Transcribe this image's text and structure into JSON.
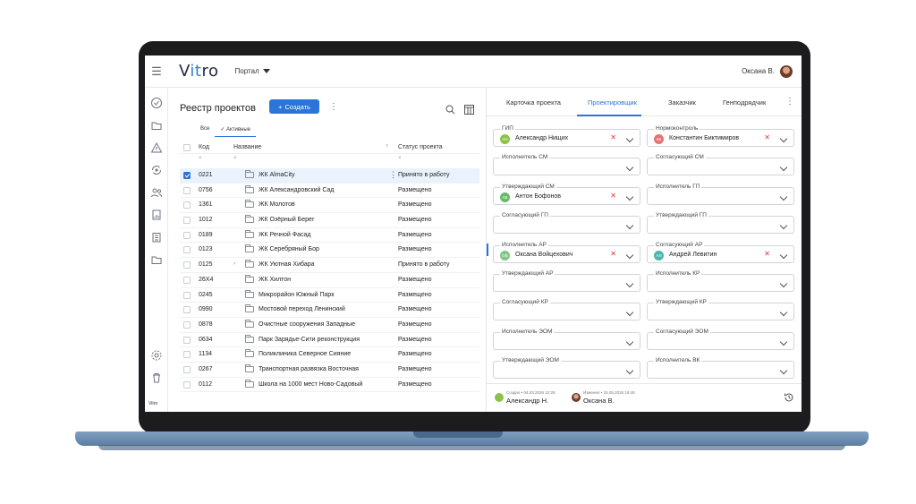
{
  "app": {
    "logo_pre": "V",
    "logo_it": "it",
    "logo_post": "ro",
    "portal": "Портал",
    "user_name": "Оксана В.",
    "brand_small": "Vitro"
  },
  "registry": {
    "title": "Реестр проектов",
    "create_label": "Создать",
    "filter_tabs": [
      "Все",
      "Активные"
    ],
    "columns": {
      "code": "Код",
      "name": "Название",
      "status": "Статус проекта"
    },
    "filter_placeholder": "×",
    "rows": [
      {
        "code": "0221",
        "name": "ЖК AlmaCity",
        "status": "Принято в работу"
      },
      {
        "code": "0756",
        "name": "ЖК Александровский Сад",
        "status": "Размещено"
      },
      {
        "code": "1361",
        "name": "ЖК Молотов",
        "status": "Размещено"
      },
      {
        "code": "1012",
        "name": "ЖК Озёрный Берег",
        "status": "Размещено"
      },
      {
        "code": "0189",
        "name": "ЖК Речной Фасад",
        "status": "Размещено"
      },
      {
        "code": "0123",
        "name": "ЖК Серебряный Бор",
        "status": "Размещено"
      },
      {
        "code": "0125",
        "name": "ЖК Уютная Хибара",
        "status": "Принято в работу"
      },
      {
        "code": "26Х4",
        "name": "ЖК Хилтон",
        "status": "Размещено"
      },
      {
        "code": "0245",
        "name": "Микрорайон Южный Парк",
        "status": "Размещено"
      },
      {
        "code": "0990",
        "name": "Мостовой переход Ленинский",
        "status": "Размещено"
      },
      {
        "code": "0878",
        "name": "Очистные сооружения Западные",
        "status": "Размещено"
      },
      {
        "code": "0634",
        "name": "Парк Зарядье-Сити реконструкция",
        "status": "Размещено"
      },
      {
        "code": "1134",
        "name": "Поликлиника Северное Сияние",
        "status": "Размещено"
      },
      {
        "code": "0267",
        "name": "Транспортная развязка Восточная",
        "status": "Размещено"
      },
      {
        "code": "0112",
        "name": "Школа на 1000 мест Ново-Садовый",
        "status": "Размещено"
      }
    ]
  },
  "details": {
    "tabs": [
      "Карточка проекта",
      "Проектировщик",
      "Заказчик",
      "Генподрядчик"
    ],
    "fields": [
      {
        "label": "ГИП",
        "value": "Александр Нищих",
        "initials": "АН",
        "color": "#8bc34a"
      },
      {
        "label": "Нормоконтроль",
        "value": "Константин Биктимиров",
        "initials": "КБ",
        "color": "#e57373"
      },
      {
        "label": "Исполнитель СМ",
        "value": ""
      },
      {
        "label": "Согласующий СМ",
        "value": ""
      },
      {
        "label": "Утверждающий СМ",
        "value": "Антон Бофонов",
        "initials": "АБ",
        "color": "#66bb6a"
      },
      {
        "label": "Исполнитель ГП",
        "value": ""
      },
      {
        "label": "Согласующий ГП",
        "value": ""
      },
      {
        "label": "Утверждающий ГП",
        "value": ""
      },
      {
        "label": "Исполнитель АР",
        "value": "Оксана Войцехович",
        "initials": "ОВ",
        "color": "#81c784"
      },
      {
        "label": "Согласующий АР",
        "value": "Андрей Левитин",
        "initials": "АЛ",
        "color": "#4db6ac"
      },
      {
        "label": "Утверждающий АР",
        "value": ""
      },
      {
        "label": "Исполнитель КР",
        "value": ""
      },
      {
        "label": "Согласующий КР",
        "value": ""
      },
      {
        "label": "Утверждающий КР",
        "value": ""
      },
      {
        "label": "Исполнитель ЭОМ",
        "value": ""
      },
      {
        "label": "Согласующий ЭОМ",
        "value": ""
      },
      {
        "label": "Утверждающий ЭОМ",
        "value": ""
      },
      {
        "label": "Исполнитель ВК",
        "value": ""
      }
    ],
    "created": {
      "meta": "Создал • 04.03.2026 12:28",
      "name": "Александр Н."
    },
    "modified": {
      "meta": "Изменил • 15.05.2026 18:49",
      "name": "Оксана В."
    }
  }
}
